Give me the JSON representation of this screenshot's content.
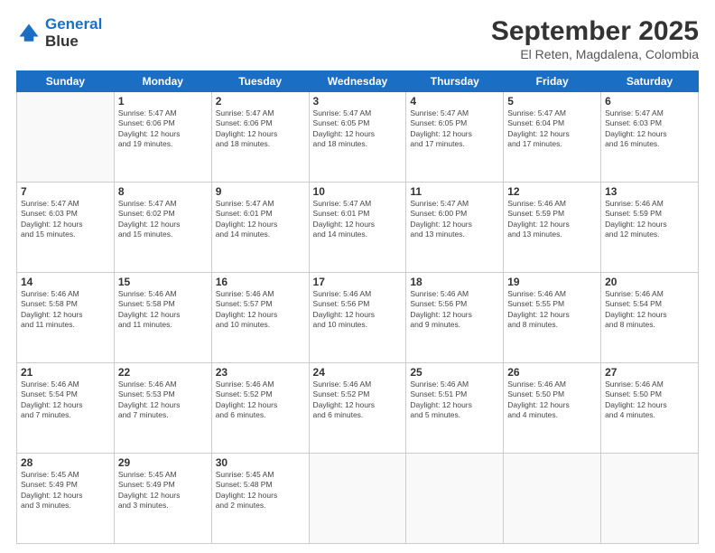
{
  "header": {
    "logo_line1": "General",
    "logo_line2": "Blue",
    "title": "September 2025",
    "subtitle": "El Reten, Magdalena, Colombia"
  },
  "weekdays": [
    "Sunday",
    "Monday",
    "Tuesday",
    "Wednesday",
    "Thursday",
    "Friday",
    "Saturday"
  ],
  "weeks": [
    [
      {
        "day": "",
        "info": ""
      },
      {
        "day": "1",
        "info": "Sunrise: 5:47 AM\nSunset: 6:06 PM\nDaylight: 12 hours\nand 19 minutes."
      },
      {
        "day": "2",
        "info": "Sunrise: 5:47 AM\nSunset: 6:06 PM\nDaylight: 12 hours\nand 18 minutes."
      },
      {
        "day": "3",
        "info": "Sunrise: 5:47 AM\nSunset: 6:05 PM\nDaylight: 12 hours\nand 18 minutes."
      },
      {
        "day": "4",
        "info": "Sunrise: 5:47 AM\nSunset: 6:05 PM\nDaylight: 12 hours\nand 17 minutes."
      },
      {
        "day": "5",
        "info": "Sunrise: 5:47 AM\nSunset: 6:04 PM\nDaylight: 12 hours\nand 17 minutes."
      },
      {
        "day": "6",
        "info": "Sunrise: 5:47 AM\nSunset: 6:03 PM\nDaylight: 12 hours\nand 16 minutes."
      }
    ],
    [
      {
        "day": "7",
        "info": "Sunrise: 5:47 AM\nSunset: 6:03 PM\nDaylight: 12 hours\nand 15 minutes."
      },
      {
        "day": "8",
        "info": "Sunrise: 5:47 AM\nSunset: 6:02 PM\nDaylight: 12 hours\nand 15 minutes."
      },
      {
        "day": "9",
        "info": "Sunrise: 5:47 AM\nSunset: 6:01 PM\nDaylight: 12 hours\nand 14 minutes."
      },
      {
        "day": "10",
        "info": "Sunrise: 5:47 AM\nSunset: 6:01 PM\nDaylight: 12 hours\nand 14 minutes."
      },
      {
        "day": "11",
        "info": "Sunrise: 5:47 AM\nSunset: 6:00 PM\nDaylight: 12 hours\nand 13 minutes."
      },
      {
        "day": "12",
        "info": "Sunrise: 5:46 AM\nSunset: 5:59 PM\nDaylight: 12 hours\nand 13 minutes."
      },
      {
        "day": "13",
        "info": "Sunrise: 5:46 AM\nSunset: 5:59 PM\nDaylight: 12 hours\nand 12 minutes."
      }
    ],
    [
      {
        "day": "14",
        "info": "Sunrise: 5:46 AM\nSunset: 5:58 PM\nDaylight: 12 hours\nand 11 minutes."
      },
      {
        "day": "15",
        "info": "Sunrise: 5:46 AM\nSunset: 5:58 PM\nDaylight: 12 hours\nand 11 minutes."
      },
      {
        "day": "16",
        "info": "Sunrise: 5:46 AM\nSunset: 5:57 PM\nDaylight: 12 hours\nand 10 minutes."
      },
      {
        "day": "17",
        "info": "Sunrise: 5:46 AM\nSunset: 5:56 PM\nDaylight: 12 hours\nand 10 minutes."
      },
      {
        "day": "18",
        "info": "Sunrise: 5:46 AM\nSunset: 5:56 PM\nDaylight: 12 hours\nand 9 minutes."
      },
      {
        "day": "19",
        "info": "Sunrise: 5:46 AM\nSunset: 5:55 PM\nDaylight: 12 hours\nand 8 minutes."
      },
      {
        "day": "20",
        "info": "Sunrise: 5:46 AM\nSunset: 5:54 PM\nDaylight: 12 hours\nand 8 minutes."
      }
    ],
    [
      {
        "day": "21",
        "info": "Sunrise: 5:46 AM\nSunset: 5:54 PM\nDaylight: 12 hours\nand 7 minutes."
      },
      {
        "day": "22",
        "info": "Sunrise: 5:46 AM\nSunset: 5:53 PM\nDaylight: 12 hours\nand 7 minutes."
      },
      {
        "day": "23",
        "info": "Sunrise: 5:46 AM\nSunset: 5:52 PM\nDaylight: 12 hours\nand 6 minutes."
      },
      {
        "day": "24",
        "info": "Sunrise: 5:46 AM\nSunset: 5:52 PM\nDaylight: 12 hours\nand 6 minutes."
      },
      {
        "day": "25",
        "info": "Sunrise: 5:46 AM\nSunset: 5:51 PM\nDaylight: 12 hours\nand 5 minutes."
      },
      {
        "day": "26",
        "info": "Sunrise: 5:46 AM\nSunset: 5:50 PM\nDaylight: 12 hours\nand 4 minutes."
      },
      {
        "day": "27",
        "info": "Sunrise: 5:46 AM\nSunset: 5:50 PM\nDaylight: 12 hours\nand 4 minutes."
      }
    ],
    [
      {
        "day": "28",
        "info": "Sunrise: 5:45 AM\nSunset: 5:49 PM\nDaylight: 12 hours\nand 3 minutes."
      },
      {
        "day": "29",
        "info": "Sunrise: 5:45 AM\nSunset: 5:49 PM\nDaylight: 12 hours\nand 3 minutes."
      },
      {
        "day": "30",
        "info": "Sunrise: 5:45 AM\nSunset: 5:48 PM\nDaylight: 12 hours\nand 2 minutes."
      },
      {
        "day": "",
        "info": ""
      },
      {
        "day": "",
        "info": ""
      },
      {
        "day": "",
        "info": ""
      },
      {
        "day": "",
        "info": ""
      }
    ]
  ]
}
